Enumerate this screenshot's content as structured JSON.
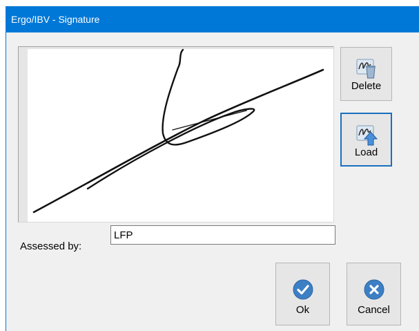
{
  "window": {
    "title": "Ergo/IBV - Signature"
  },
  "buttons": {
    "delete_label": "Delete",
    "load_label": "Load",
    "ok_label": "Ok",
    "cancel_label": "Cancel"
  },
  "form": {
    "assessed_by_label": "Assessed by:",
    "assessed_by_value": "LFP"
  },
  "icons": {
    "delete": "signature-delete-icon",
    "load": "signature-load-icon",
    "ok": "checkmark-circle-icon",
    "cancel": "x-circle-icon"
  },
  "colors": {
    "titlebar": "#0078d7",
    "accent_circle": "#3c7fc4",
    "window_bg": "#f0f0f0"
  }
}
